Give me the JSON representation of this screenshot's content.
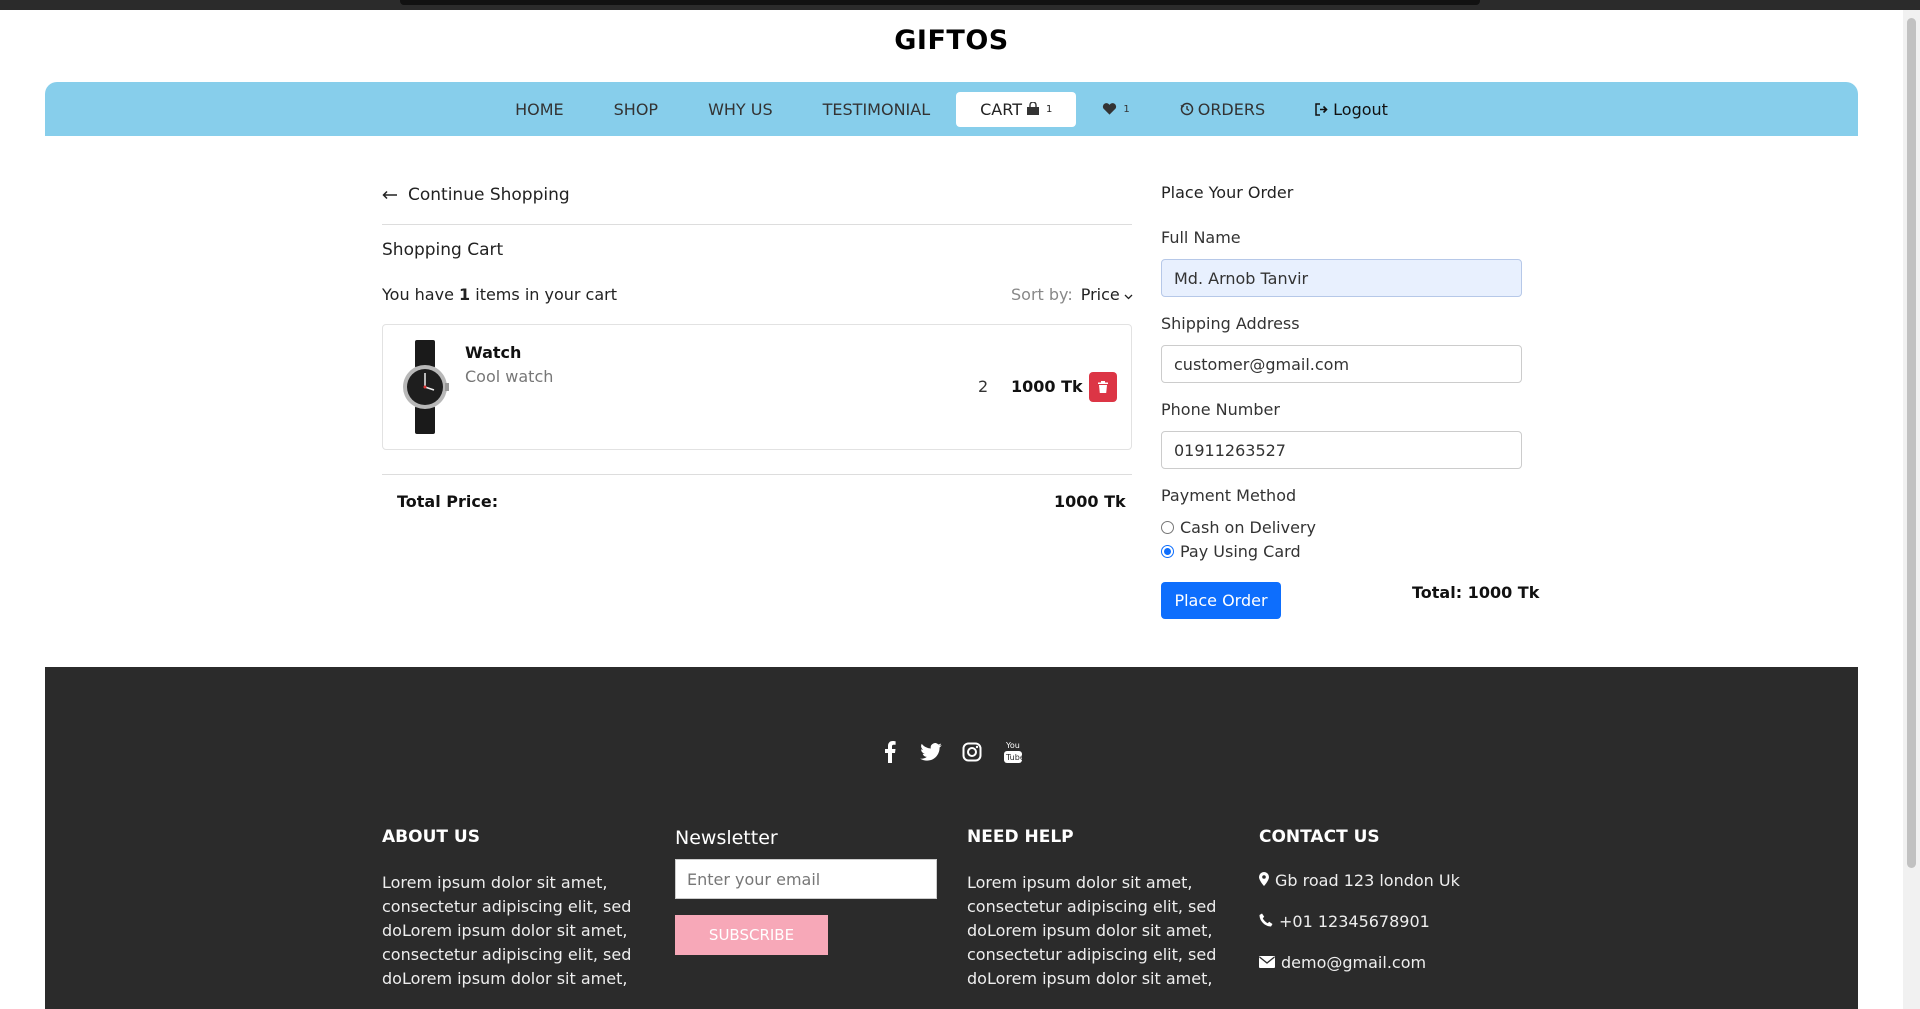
{
  "brand": "GIFTOS",
  "nav": {
    "home": "HOME",
    "shop": "SHOP",
    "why_us": "WHY US",
    "testimonial": "TESTIMONIAL",
    "cart": "CART",
    "cart_count": "1",
    "wishlist_count": "1",
    "orders": "ORDERS",
    "logout": "Logout"
  },
  "cart": {
    "continue_label": "Continue Shopping",
    "title": "Shopping Cart",
    "count_prefix": "You have ",
    "count": "1",
    "count_suffix": " items in your cart",
    "sort_label": "Sort by:",
    "sort_value": "Price",
    "items": [
      {
        "name": "Watch",
        "description": "Cool watch",
        "quantity": "2",
        "price": "1000 Tk"
      }
    ],
    "total_label": "Total Price:",
    "total_value": "1000 Tk"
  },
  "order_form": {
    "title": "Place Your Order",
    "full_name_label": "Full Name",
    "full_name_value": "Md. Arnob Tanvir",
    "address_label": "Shipping Address",
    "address_value": "customer@gmail.com",
    "phone_label": "Phone Number",
    "phone_value": "01911263527",
    "payment_label": "Payment Method",
    "payment_options": [
      "Cash on Delivery",
      "Pay Using Card"
    ],
    "payment_selected": "Pay Using Card",
    "submit_label": "Place Order",
    "total_text": "Total: 1000 Tk"
  },
  "footer": {
    "social_icons": [
      "facebook-icon",
      "twitter-icon",
      "instagram-icon",
      "youtube-icon"
    ],
    "about_title": "ABOUT US",
    "about_text": "Lorem ipsum dolor sit amet, consectetur adipiscing elit, sed doLorem ipsum dolor sit amet, consectetur adipiscing elit, sed doLorem ipsum dolor sit amet,",
    "newsletter_title": "Newsletter",
    "newsletter_placeholder": "Enter your email",
    "subscribe_label": "SUBSCRIBE",
    "help_title": "NEED HELP",
    "help_text": "Lorem ipsum dolor sit amet, consectetur adipiscing elit, sed doLorem ipsum dolor sit amet, consectetur adipiscing elit, sed doLorem ipsum dolor sit amet,",
    "contact_title": "CONTACT US",
    "contact_address": "Gb road 123 london Uk",
    "contact_phone": "+01 12345678901",
    "contact_email": "demo@gmail.com"
  },
  "colors": {
    "nav_bg": "#87ceeb",
    "primary": "#0d6efd",
    "danger": "#dc3545",
    "footer_bg": "#2b2b2b",
    "subscribe_bg": "#f7a8b8"
  }
}
